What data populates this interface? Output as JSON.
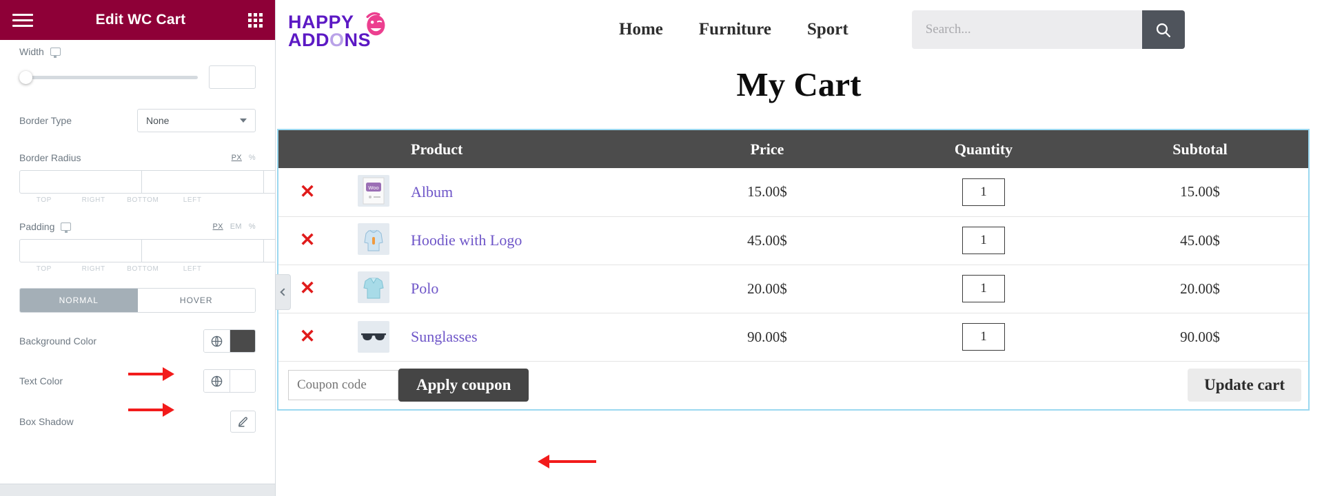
{
  "panel": {
    "title": "Edit WC Cart",
    "menu_icon": "hamburger-icon",
    "apps_icon": "grid-icon",
    "controls": {
      "width": {
        "label": "Width",
        "value": "",
        "slider_percent": 0
      },
      "border_type": {
        "label": "Border Type",
        "value": "None"
      },
      "border_radius": {
        "label": "Border Radius",
        "units": [
          "PX",
          "%"
        ],
        "active_unit": "PX",
        "values": [
          "",
          "",
          "",
          ""
        ],
        "side_labels": [
          "TOP",
          "RIGHT",
          "BOTTOM",
          "LEFT"
        ]
      },
      "padding": {
        "label": "Padding",
        "units": [
          "PX",
          "EM",
          "%"
        ],
        "active_unit": "PX",
        "values": [
          "",
          "",
          "",
          ""
        ],
        "side_labels": [
          "TOP",
          "RIGHT",
          "BOTTOM",
          "LEFT"
        ]
      },
      "state_tabs": {
        "normal": "NORMAL",
        "hover": "HOVER",
        "active": "NORMAL"
      },
      "background_color": {
        "label": "Background Color",
        "swatch": "#4a4a4a"
      },
      "text_color": {
        "label": "Text Color",
        "swatch": "#ffffff"
      },
      "box_shadow": {
        "label": "Box Shadow"
      }
    },
    "collapse_handle": "‹",
    "accent_color": "#8e0037",
    "annotation_color": "#f21b1b"
  },
  "site": {
    "logo": {
      "line1": "HAPPY",
      "line2_pre": "ADD",
      "line2_o": "O",
      "line2_post": "NS"
    },
    "nav": [
      {
        "label": "Home"
      },
      {
        "label": "Furniture"
      },
      {
        "label": "Sport"
      }
    ],
    "search": {
      "placeholder": "Search...",
      "value": "",
      "button_icon": "search-icon"
    }
  },
  "cart": {
    "title": "My Cart",
    "columns": [
      "",
      "",
      "Product",
      "Price",
      "Quantity",
      "Subtotal"
    ],
    "remove_glyph": "✕",
    "rows": [
      {
        "name": "Album",
        "price": "15.00$",
        "qty": "1",
        "subtotal": "15.00$",
        "thumb": "woo-placeholder-image"
      },
      {
        "name": "Hoodie with Logo",
        "price": "45.00$",
        "qty": "1",
        "subtotal": "45.00$",
        "thumb": "hoodie-image"
      },
      {
        "name": "Polo",
        "price": "20.00$",
        "qty": "1",
        "subtotal": "20.00$",
        "thumb": "polo-shirt-image"
      },
      {
        "name": "Sunglasses",
        "price": "90.00$",
        "qty": "1",
        "subtotal": "90.00$",
        "thumb": "sunglasses-image"
      }
    ],
    "coupon": {
      "placeholder": "Coupon code",
      "value": "",
      "apply_label": "Apply coupon",
      "update_label": "Update cart"
    }
  }
}
